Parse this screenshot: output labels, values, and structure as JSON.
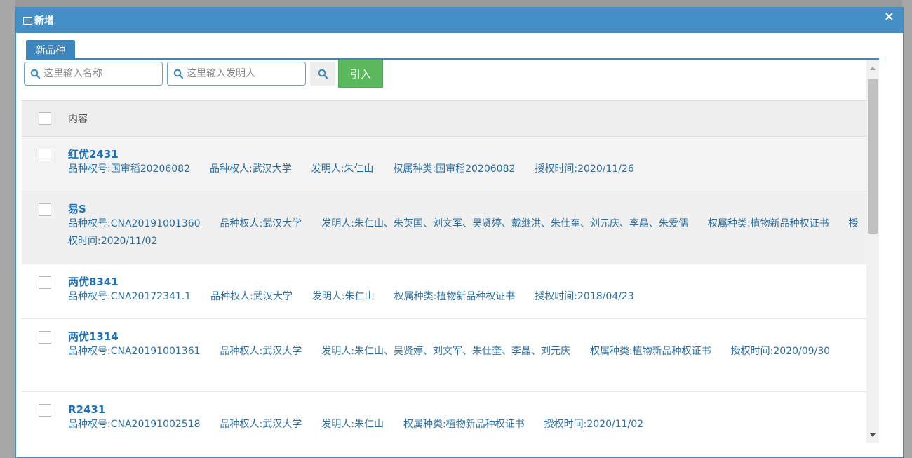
{
  "dialog": {
    "title": "新增",
    "close_label": "×"
  },
  "tabs": [
    {
      "label": "新品种"
    }
  ],
  "toolbar": {
    "name_placeholder": "这里输入名称",
    "inventor_placeholder": "这里输入发明人",
    "import_label": "引入"
  },
  "table": {
    "header_label": "内容",
    "rows": [
      {
        "name": "红优2431",
        "meta": "品种权号:国审稻20206082　　品种权人:武汉大学　　发明人:朱仁山　　权属种类:国审稻20206082　　授权时间:2020/11/26"
      },
      {
        "name": "易S",
        "meta": "品种权号:CNA20191001360　　品种权人:武汉大学　　发明人:朱仁山、朱英国、刘文军、吴贤婷、戴继洪、朱仕奎、刘元庆、李晶、朱爱儒　　权属种类:植物新品种权证书　　授权时间:2020/11/02"
      },
      {
        "name": "两优8341",
        "meta": "品种权号:CNA20172341.1　　品种权人:武汉大学　　发明人:朱仁山　　权属种类:植物新品种权证书　　授权时间:2018/04/23"
      },
      {
        "name": "两优1314",
        "meta": "品种权号:CNA20191001361　　品种权人:武汉大学　　发明人:朱仁山、吴贤婷、刘文军、朱仕奎、李晶、刘元庆　　权属种类:植物新品种权证书　　授权时间:2020/09/30"
      },
      {
        "name": "R2431",
        "meta": "品种权号:CNA20191002518　　品种权人:武汉大学　　发明人:朱仁山　　权属种类:植物新品种权证书　　授权时间:2020/11/02"
      }
    ]
  }
}
